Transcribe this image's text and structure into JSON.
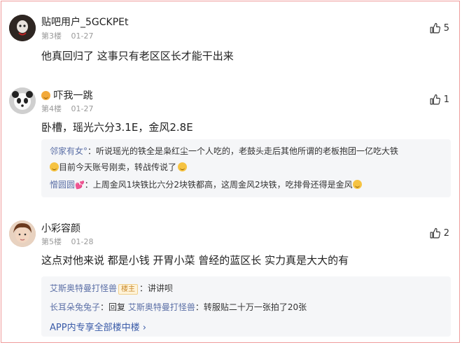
{
  "posts": [
    {
      "username": "贴吧用户_5GCKPEt",
      "floor": "第3楼",
      "date": "01-27",
      "content": "他真回归了 这事只有老区区长才能干出来",
      "likes": "5",
      "replies": []
    },
    {
      "username": "吓我一跳",
      "floor": "第4楼",
      "date": "01-27",
      "content": "卧槽，瑶光六分3.1E，金风2.8E",
      "likes": "1",
      "replies": [
        {
          "name": "邻家有女°",
          "text_a": "：听说瑶光的铁全是枭红尘一个人吃的，老鼓头走后其他所谓的老板抱团一亿吃大铁",
          "text_b": "目前今天账号刚卖，转战传说了"
        },
        {
          "name": "憎圆圆",
          "text_a": "：上周金风1块铁比六分2块铁都高，这周金风2块铁，吃排骨还得是金风",
          "text_b": ""
        }
      ]
    },
    {
      "username": "小彩容颜",
      "floor": "第5楼",
      "date": "01-28",
      "content": "这点对他来说 都是小钱 开胃小菜 曾经的蓝区长 实力真是大大的有",
      "likes": "2",
      "replies": [
        {
          "name": "艾斯奥特曼打怪兽",
          "badge": "楼主",
          "text": "：讲讲呗"
        },
        {
          "name": "长耳朵兔兔子",
          "text_a": "：回复 ",
          "target": "艾斯奥特曼打怪兽",
          "text_b": "：转服贴二十万一张拍了20张"
        }
      ],
      "more_link": "APP内专享全部楼中楼 ›"
    }
  ],
  "icons": {
    "like": "thumbs-up-icon",
    "more": "chevron-right-icon"
  },
  "colors": {
    "border": "#ef9b9b",
    "reply_name": "#5b6fa6",
    "link": "#3a5ba8"
  }
}
